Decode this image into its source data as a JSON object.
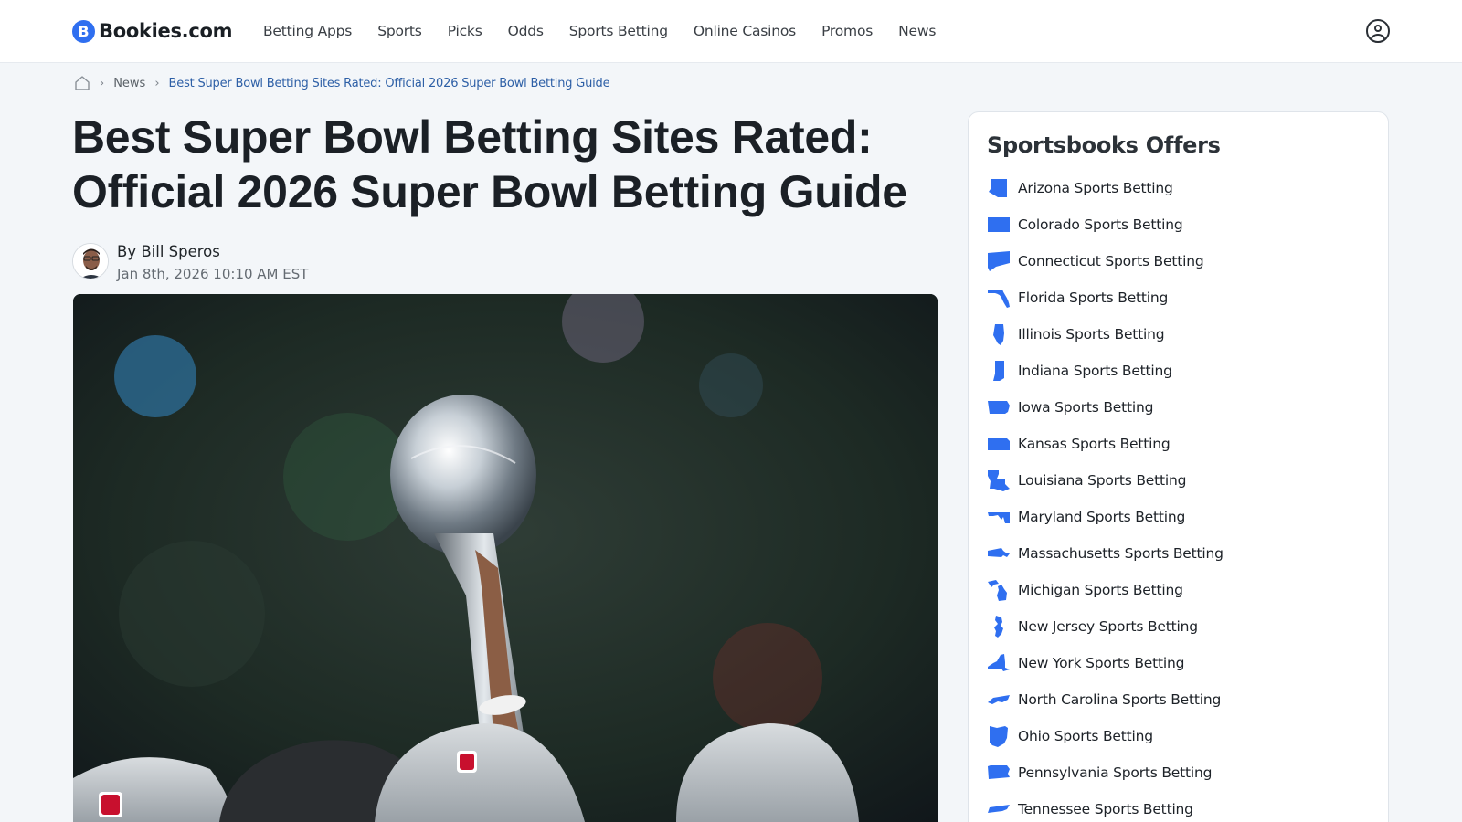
{
  "header": {
    "logo_letter": "B",
    "logo_text": "Bookies.com",
    "nav": [
      "Betting Apps",
      "Sports",
      "Picks",
      "Odds",
      "Sports Betting",
      "Online Casinos",
      "Promos",
      "News"
    ],
    "account_icon": "user-circle-icon"
  },
  "breadcrumb": {
    "home_icon": "home-icon",
    "separator": "›",
    "items": [
      "News"
    ],
    "current": "Best Super Bowl Betting Sites Rated: Official 2026 Super Bowl Betting Guide"
  },
  "article": {
    "title": "Best Super Bowl Betting Sites Rated: Official 2026 Super Bowl Betting Guide",
    "author": "By Bill Speros",
    "date": "Jan 8th, 2026 10:10 AM EST"
  },
  "sidebar": {
    "title": "Sportsbooks Offers",
    "icon_color": "#2f6ff0",
    "offers": [
      {
        "label": "Arizona Sports Betting",
        "icon": "arizona-icon"
      },
      {
        "label": "Colorado Sports Betting",
        "icon": "colorado-icon"
      },
      {
        "label": "Connecticut Sports Betting",
        "icon": "connecticut-icon"
      },
      {
        "label": "Florida Sports Betting",
        "icon": "florida-icon"
      },
      {
        "label": "Illinois Sports Betting",
        "icon": "illinois-icon"
      },
      {
        "label": "Indiana Sports Betting",
        "icon": "indiana-icon"
      },
      {
        "label": "Iowa Sports Betting",
        "icon": "iowa-icon"
      },
      {
        "label": "Kansas Sports Betting",
        "icon": "kansas-icon"
      },
      {
        "label": "Louisiana Sports Betting",
        "icon": "louisiana-icon"
      },
      {
        "label": "Maryland Sports Betting",
        "icon": "maryland-icon"
      },
      {
        "label": "Massachusetts Sports Betting",
        "icon": "massachusetts-icon"
      },
      {
        "label": "Michigan Sports Betting",
        "icon": "michigan-icon"
      },
      {
        "label": "New Jersey Sports Betting",
        "icon": "new-jersey-icon"
      },
      {
        "label": "New York Sports Betting",
        "icon": "new-york-icon"
      },
      {
        "label": "North Carolina Sports Betting",
        "icon": "north-carolina-icon"
      },
      {
        "label": "Ohio Sports Betting",
        "icon": "ohio-icon"
      },
      {
        "label": "Pennsylvania Sports Betting",
        "icon": "pennsylvania-icon"
      },
      {
        "label": "Tennessee Sports Betting",
        "icon": "tennessee-icon"
      }
    ]
  }
}
